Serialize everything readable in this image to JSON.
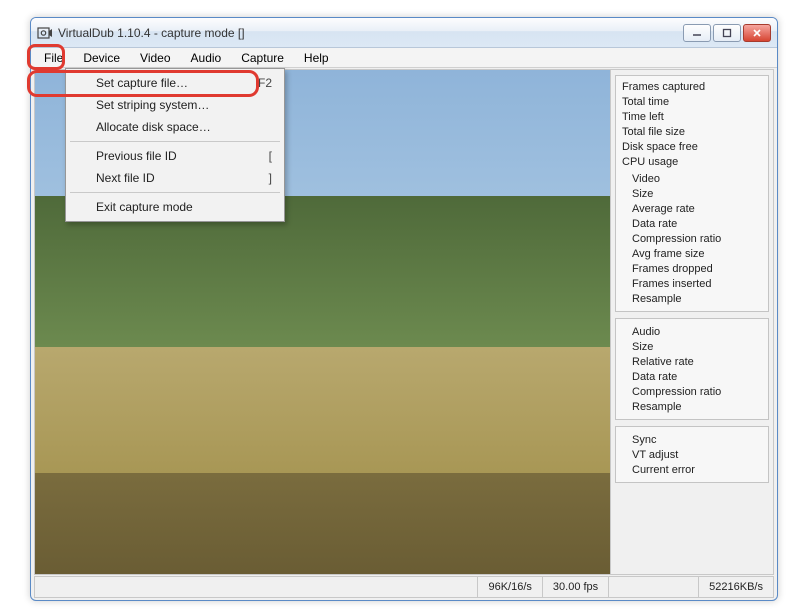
{
  "window": {
    "title": "VirtualDub 1.10.4 - capture mode []"
  },
  "menubar": {
    "file": "File",
    "device": "Device",
    "video": "Video",
    "audio": "Audio",
    "capture": "Capture",
    "help": "Help"
  },
  "file_menu": {
    "set_capture_file": "Set capture file…",
    "set_capture_file_shortcut": "F2",
    "set_striping_system": "Set striping system…",
    "allocate_disk_space": "Allocate disk space…",
    "previous_file_id": "Previous file ID",
    "previous_file_id_shortcut": "[",
    "next_file_id": "Next file ID",
    "next_file_id_shortcut": "]",
    "exit_capture_mode": "Exit capture mode"
  },
  "panel_top": {
    "frames_captured": "Frames captured",
    "total_time": "Total time",
    "time_left": "Time left",
    "total_file_size": "Total file size",
    "disk_space_free": "Disk space free",
    "cpu_usage": "CPU usage"
  },
  "panel_video": {
    "header": "Video",
    "size": "Size",
    "avg_rate": "Average rate",
    "data_rate": "Data rate",
    "compression_ratio": "Compression ratio",
    "avg_frame_size": "Avg frame size",
    "frames_dropped": "Frames dropped",
    "frames_inserted": "Frames inserted",
    "resample": "Resample"
  },
  "panel_audio": {
    "header": "Audio",
    "size": "Size",
    "relative_rate": "Relative rate",
    "data_rate": "Data rate",
    "compression_ratio": "Compression ratio",
    "resample": "Resample"
  },
  "panel_sync": {
    "header": "Sync",
    "vt_adjust": "VT adjust",
    "current_error": "Current error"
  },
  "status": {
    "rate": "96K/16/s",
    "fps": "30.00 fps",
    "kbps": "52216KB/s"
  }
}
